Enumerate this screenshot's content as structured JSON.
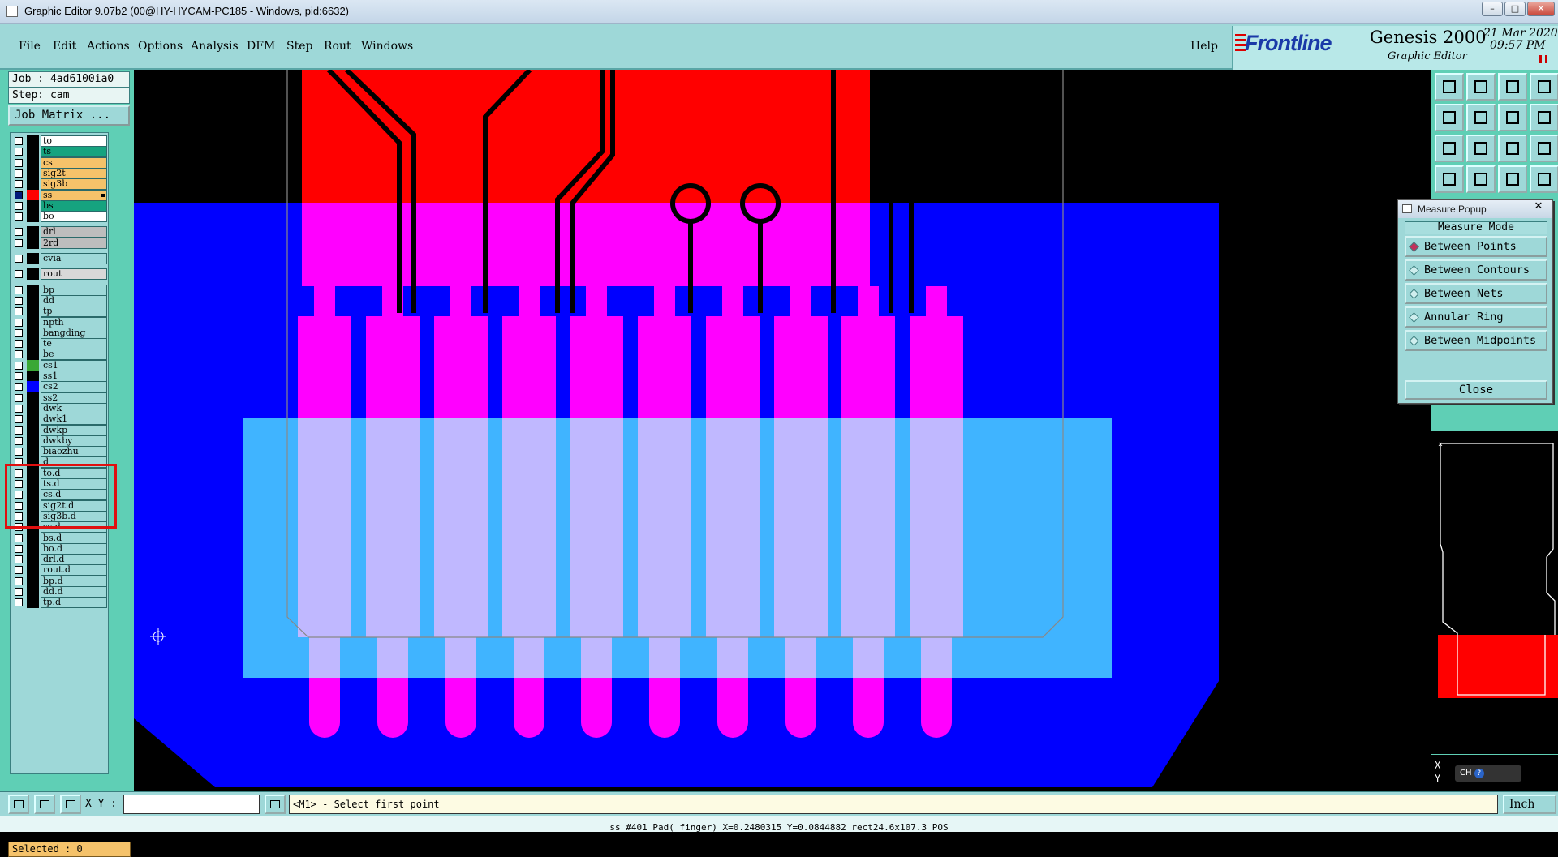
{
  "window": {
    "title": "Graphic Editor 9.07b2 (00@HY-HYCAM-PC185 - Windows, pid:6632)"
  },
  "menu": [
    "File",
    "Edit",
    "Actions",
    "Options",
    "Analysis",
    "DFM",
    "Step",
    "Rout",
    "Windows"
  ],
  "help_label": "Help",
  "brand": {
    "logo": "Frontline",
    "product": "Genesis 2000",
    "subtitle": "Graphic Editor",
    "date": "21 Mar 2020",
    "time": "09:57 PM"
  },
  "job": {
    "job_label": "Job : 4ad6100ia0",
    "step_label": "Step: cam",
    "matrix_button": "Job Matrix ..."
  },
  "layers": [
    {
      "name": "to",
      "color": "#ffffff"
    },
    {
      "name": "ts",
      "color": "#16a37f"
    },
    {
      "name": "cs",
      "color": "#f5c26a"
    },
    {
      "name": "sig2t",
      "color": "#f5c26a"
    },
    {
      "name": "sig3b",
      "color": "#f5c26a"
    },
    {
      "name": "ss",
      "color": "#f5c26a"
    },
    {
      "name": "bs",
      "color": "#16a37f"
    },
    {
      "name": "bo",
      "color": "#ffffff"
    },
    {
      "name": "drl",
      "color": "#bdbdbd"
    },
    {
      "name": "2rd",
      "color": "#bdbdbd"
    },
    {
      "name": "cvia",
      "color": "#9ed8d8"
    },
    {
      "name": "rout",
      "color": "#d8d8d8"
    },
    {
      "name": "bp",
      "color": "#9ed8d8"
    },
    {
      "name": "dd",
      "color": "#9ed8d8"
    },
    {
      "name": "tp",
      "color": "#9ed8d8"
    },
    {
      "name": "npth",
      "color": "#9ed8d8"
    },
    {
      "name": "bangding",
      "color": "#9ed8d8"
    },
    {
      "name": "te",
      "color": "#9ed8d8"
    },
    {
      "name": "be",
      "color": "#9ed8d8"
    },
    {
      "name": "cs1",
      "color": "#9ed8d8"
    },
    {
      "name": "ss1",
      "color": "#9ed8d8"
    },
    {
      "name": "cs2",
      "color": "#9ed8d8"
    },
    {
      "name": "ss2",
      "color": "#9ed8d8"
    },
    {
      "name": "dwk",
      "color": "#9ed8d8"
    },
    {
      "name": "dwk1",
      "color": "#9ed8d8"
    },
    {
      "name": "dwkp",
      "color": "#9ed8d8"
    },
    {
      "name": "dwkby",
      "color": "#9ed8d8"
    },
    {
      "name": "biaozhu",
      "color": "#9ed8d8"
    },
    {
      "name": "d",
      "color": "#9ed8d8"
    },
    {
      "name": "to.d",
      "color": "#9ed8d8"
    },
    {
      "name": "ts.d",
      "color": "#9ed8d8"
    },
    {
      "name": "cs.d",
      "color": "#9ed8d8"
    },
    {
      "name": "sig2t.d",
      "color": "#9ed8d8"
    },
    {
      "name": "sig3b.d",
      "color": "#9ed8d8"
    },
    {
      "name": "ss.d",
      "color": "#9ed8d8"
    },
    {
      "name": "bs.d",
      "color": "#9ed8d8"
    },
    {
      "name": "bo.d",
      "color": "#9ed8d8"
    },
    {
      "name": "drl.d",
      "color": "#9ed8d8"
    },
    {
      "name": "rout.d",
      "color": "#9ed8d8"
    },
    {
      "name": "bp.d",
      "color": "#9ed8d8"
    },
    {
      "name": "dd.d",
      "color": "#9ed8d8"
    },
    {
      "name": "tp.d",
      "color": "#9ed8d8"
    }
  ],
  "selected_label": "Selected : 0",
  "measure_popup": {
    "title": "Measure Popup",
    "mode_header": "Measure Mode",
    "options": [
      "Between Points",
      "Between Contours",
      "Between Nets",
      "Annular Ring",
      "Between Midpoints"
    ],
    "active_option": "Between Points",
    "close_label": "Close"
  },
  "coords": {
    "x_label": "X",
    "y_label": "Y",
    "ime": "CH"
  },
  "bottom": {
    "xy_label": "X Y :",
    "prompt": "<M1> - Select first point",
    "units": "Inch"
  },
  "status": "ss #401 Pad( finger) X=0.2480315 Y=0.0844882 rect24.6x107.3 POS",
  "colors": {
    "red": "#ff0000",
    "blue": "#0000ff",
    "magenta": "#ff00ff",
    "lightblue": "#40b4ff",
    "lavender": "#c0b8ff",
    "panel": "#5fcfb5"
  }
}
